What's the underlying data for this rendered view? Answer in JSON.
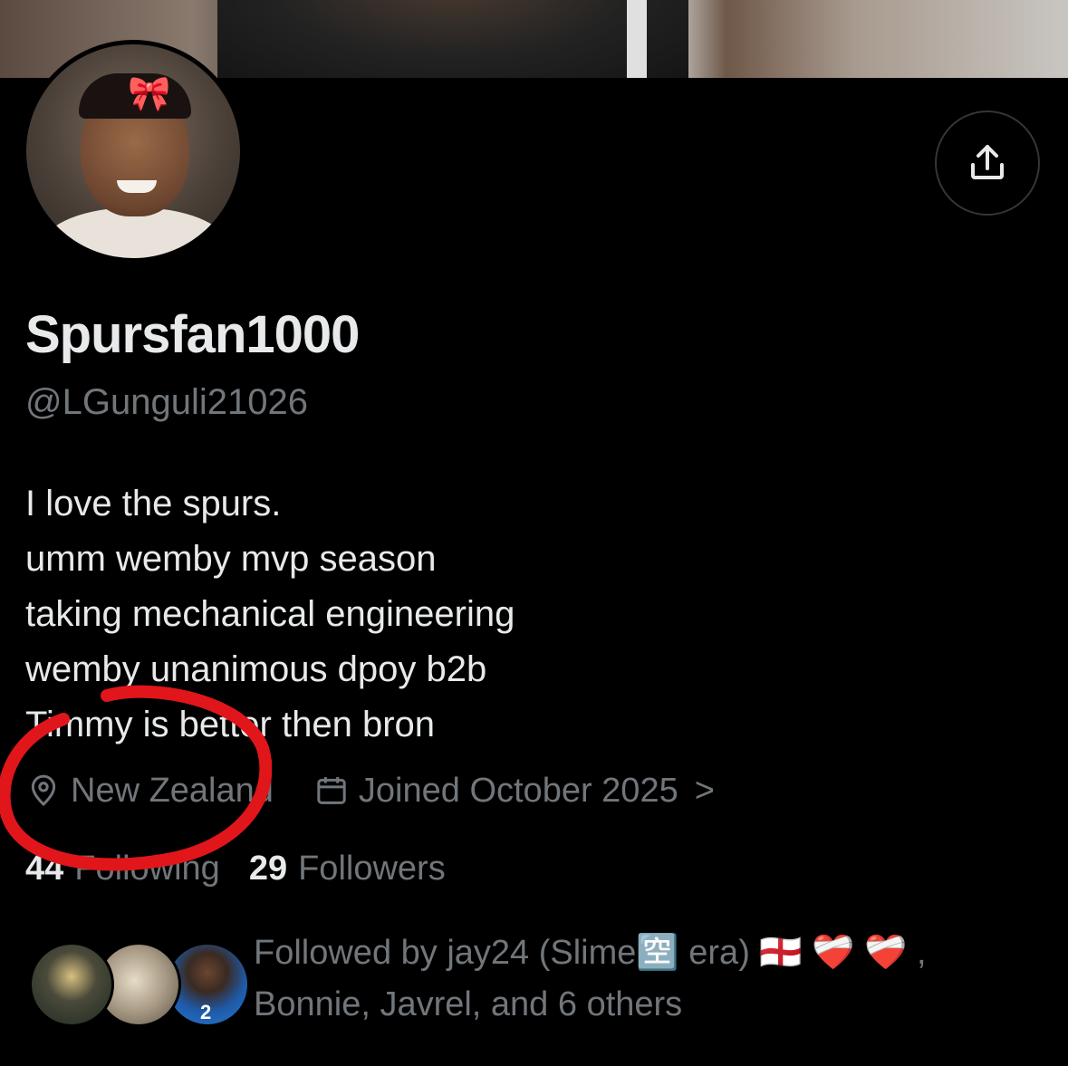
{
  "profile": {
    "display_name": "Spursfan1000",
    "handle": "@LGunguli21026",
    "bio_lines": [
      "I love the spurs.",
      "umm wemby mvp season",
      "taking mechanical engineering",
      "wemby unanimous dpoy b2b",
      "Timmy is better then bron"
    ],
    "location": "New Zealand",
    "joined": "Joined October 2025",
    "joined_chevron": ">"
  },
  "stats": {
    "following_count": "44",
    "following_label": "Following",
    "followers_count": "29",
    "followers_label": "Followers"
  },
  "followed_by": {
    "line1": "Followed by jay24 (Slime🈳 era) 🏴󠁧󠁢󠁥󠁮󠁧󠁿 ❤️‍🩹 ❤️‍🩹 ,",
    "line2": "Bonnie, Javrel, and 6 others",
    "avatar3_number": "2"
  },
  "icons": {
    "share": "share-icon",
    "location": "location-pin-icon",
    "calendar": "calendar-icon",
    "bow": "🎀"
  },
  "colors": {
    "background": "#000000",
    "primary_text": "#e7e9ea",
    "secondary_text": "#71767b",
    "annotation": "#e0161b"
  }
}
